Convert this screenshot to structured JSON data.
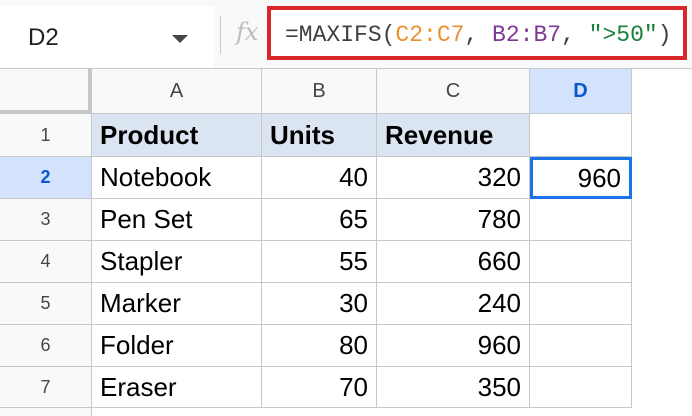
{
  "formula_bar": {
    "name_box": "D2",
    "fx_label": "fx",
    "formula": {
      "prefix": "=MAXIFS(",
      "range1": "C2:C7",
      "sep1": ", ",
      "range2": "B2:B7",
      "sep2": ", ",
      "criterion": "\">50\"",
      "suffix": ")"
    }
  },
  "columns": [
    "A",
    "B",
    "C",
    "D"
  ],
  "active_column": "D",
  "rows": [
    "1",
    "2",
    "3",
    "4",
    "5",
    "6",
    "7"
  ],
  "active_row": "2",
  "table": {
    "headers": [
      "Product",
      "Units",
      "Revenue"
    ],
    "data": [
      {
        "product": "Notebook",
        "units": "40",
        "revenue": "320",
        "d": "960"
      },
      {
        "product": "Pen Set",
        "units": "65",
        "revenue": "780",
        "d": ""
      },
      {
        "product": "Stapler",
        "units": "55",
        "revenue": "660",
        "d": ""
      },
      {
        "product": "Marker",
        "units": "30",
        "revenue": "240",
        "d": ""
      },
      {
        "product": "Folder",
        "units": "80",
        "revenue": "960",
        "d": ""
      },
      {
        "product": "Eraser",
        "units": "70",
        "revenue": "350",
        "d": ""
      }
    ]
  },
  "colors": {
    "formula_highlight_border": "#d9262b",
    "selection": "#1a73e8",
    "header_fill": "#dbe5f1",
    "range1": "#e8912d",
    "range2": "#7e3794",
    "string": "#188038"
  }
}
